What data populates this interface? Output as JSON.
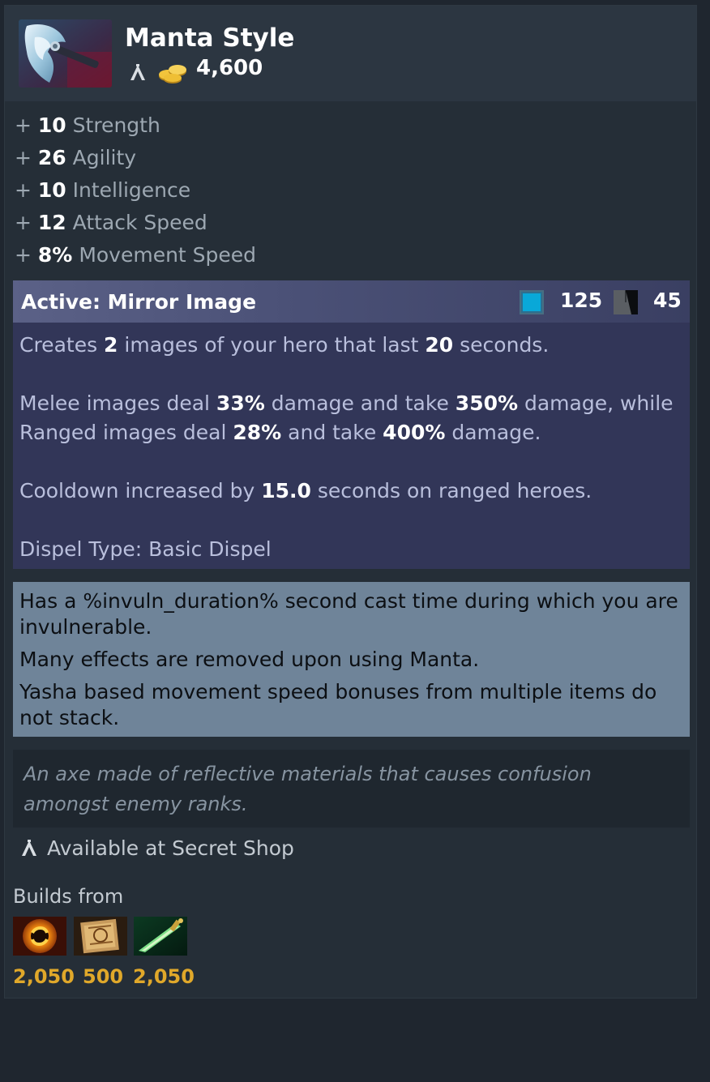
{
  "item": {
    "name": "Manta Style",
    "cost": "4,600",
    "image_icon": "manta-axe-icon"
  },
  "attributes": [
    {
      "plus": "+",
      "value": "10",
      "label": "Strength"
    },
    {
      "plus": "+",
      "value": "26",
      "label": "Agility"
    },
    {
      "plus": "+",
      "value": "10",
      "label": "Intelligence"
    },
    {
      "plus": "+",
      "value": "12",
      "label": "Attack Speed"
    },
    {
      "plus": "+",
      "value": "8%",
      "label": "Movement Speed"
    }
  ],
  "active": {
    "title": "Active: Mirror Image",
    "mana_cost": "125",
    "cooldown": "45",
    "line1": {
      "a": "Creates ",
      "n1": "2",
      "b": " images of your hero that last ",
      "n2": "20",
      "c": " seconds."
    },
    "line2": {
      "a": "Melee images deal ",
      "n1": "33%",
      "b": " damage and take ",
      "n2": "350%",
      "c": " damage, while"
    },
    "line3": {
      "a": "Ranged images deal ",
      "n1": "28%",
      "b": " and take ",
      "n2": "400%",
      "c": " damage."
    },
    "line4": {
      "a": "Cooldown increased by ",
      "n1": "15.0",
      "b": " seconds on ranged heroes."
    },
    "dispel": "Dispel Type: Basic Dispel"
  },
  "notes": [
    "Has a %invuln_duration% second cast time during which you are invulnerable.",
    "Many effects are removed upon using Manta.",
    "Yasha based movement speed bonuses from multiple items do not stack."
  ],
  "lore": "An axe made of reflective materials that causes confusion amongst enemy ranks.",
  "shop": {
    "label": "Available at Secret Shop",
    "icon": "secret-shop-icon"
  },
  "builds": {
    "label": "Builds from",
    "components": [
      {
        "icon": "yasha-orb-icon",
        "price": "2,050"
      },
      {
        "icon": "recipe-scroll-icon",
        "price": "500"
      },
      {
        "icon": "ultimate-orb-blade-icon",
        "price": "2,050"
      }
    ]
  },
  "colors": {
    "background": "#1f262f",
    "card": "#252e37",
    "active_header": "#5b6187",
    "active_body": "#323658",
    "notes": "#6f8499",
    "mana": "#09a8d8",
    "price": "#e0a82a"
  }
}
